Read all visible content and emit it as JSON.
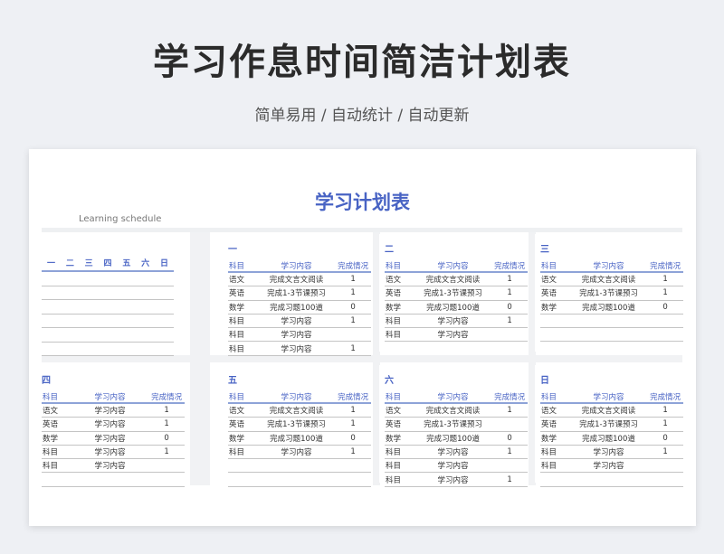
{
  "header": {
    "title": "学习作息时间简洁计划表",
    "subtitle": "简单易用 / 自动统计 / 自动更新"
  },
  "sheet": {
    "title": "学习计划表",
    "subtitle": "Learning schedule"
  },
  "week": {
    "days": [
      "一",
      "二",
      "三",
      "四",
      "五",
      "六",
      "日"
    ]
  },
  "columns": [
    "科目",
    "学习内容",
    "完成情况"
  ],
  "panels": [
    {
      "title": "一",
      "rows": [
        [
          "语文",
          "完成文言文阅读",
          "1"
        ],
        [
          "英语",
          "完成1-3节课预习",
          "1"
        ],
        [
          "数学",
          "完成习题100道",
          "0"
        ],
        [
          "科目",
          "学习内容",
          "1"
        ],
        [
          "科目",
          "学习内容",
          ""
        ],
        [
          "科目",
          "学习内容",
          "1"
        ]
      ]
    },
    {
      "title": "二",
      "rows": [
        [
          "语文",
          "完成文言文阅读",
          "1"
        ],
        [
          "英语",
          "完成1-3节课预习",
          "1"
        ],
        [
          "数学",
          "完成习题100道",
          "0"
        ],
        [
          "科目",
          "学习内容",
          "1"
        ],
        [
          "科目",
          "学习内容",
          ""
        ]
      ]
    },
    {
      "title": "三",
      "rows": [
        [
          "语文",
          "完成文言文阅读",
          "1"
        ],
        [
          "英语",
          "完成1-3节课预习",
          "1"
        ],
        [
          "数学",
          "完成习题100道",
          "0"
        ],
        [
          "",
          "",
          ""
        ],
        [
          "",
          "",
          ""
        ]
      ]
    },
    {
      "title": "四",
      "rows": [
        [
          "语文",
          "学习内容",
          "1"
        ],
        [
          "英语",
          "学习内容",
          "1"
        ],
        [
          "数学",
          "学习内容",
          "0"
        ],
        [
          "科目",
          "学习内容",
          "1"
        ],
        [
          "科目",
          "学习内容",
          ""
        ],
        [
          "",
          "",
          ""
        ]
      ]
    },
    {
      "title": "五",
      "rows": [
        [
          "语文",
          "完成文言文阅读",
          "1"
        ],
        [
          "英语",
          "完成1-3节课预习",
          "1"
        ],
        [
          "数学",
          "完成习题100道",
          "0"
        ],
        [
          "科目",
          "学习内容",
          "1"
        ],
        [
          "",
          "",
          ""
        ],
        [
          "",
          "",
          ""
        ]
      ]
    },
    {
      "title": "六",
      "rows": [
        [
          "语文",
          "完成文言文阅读",
          "1"
        ],
        [
          "英语",
          "完成1-3节课预习",
          ""
        ],
        [
          "数学",
          "完成习题100道",
          "0"
        ],
        [
          "科目",
          "学习内容",
          "1"
        ],
        [
          "科目",
          "学习内容",
          ""
        ],
        [
          "科目",
          "学习内容",
          "1"
        ]
      ]
    },
    {
      "title": "日",
      "rows": [
        [
          "语文",
          "完成文言文阅读",
          "1"
        ],
        [
          "英语",
          "完成1-3节课预习",
          "1"
        ],
        [
          "数学",
          "完成习题100道",
          "0"
        ],
        [
          "科目",
          "学习内容",
          "1"
        ],
        [
          "科目",
          "学习内容",
          ""
        ],
        [
          "",
          "",
          ""
        ]
      ]
    }
  ]
}
